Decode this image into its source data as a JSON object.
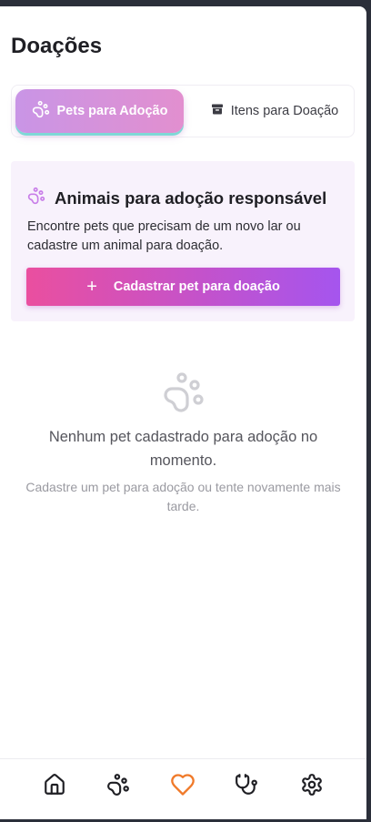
{
  "header": {
    "title": "Doações"
  },
  "tabs": [
    {
      "label": "Pets para Adoção",
      "icon": "paw-icon",
      "active": true
    },
    {
      "label": "Itens para Doação",
      "icon": "archive-box-icon",
      "active": false
    }
  ],
  "info_card": {
    "icon": "paw-icon",
    "title": "Animais para adoção responsável",
    "description": "Encontre pets que precisam de um novo lar ou cadastre um animal para doação.",
    "cta_icon": "plus-icon",
    "cta_label": "Cadastrar pet para doação"
  },
  "empty_state": {
    "icon": "paw-icon",
    "title": "Nenhum pet cadastrado para adoção no momento.",
    "subtitle": "Cadastre um pet para adoção ou tente novamente mais tarde."
  },
  "bottom_nav": [
    {
      "name": "home",
      "icon": "home-icon",
      "active": false
    },
    {
      "name": "pets",
      "icon": "paw-icon",
      "active": false
    },
    {
      "name": "donations",
      "icon": "heart-icon",
      "active": true
    },
    {
      "name": "health",
      "icon": "stethoscope-icon",
      "active": false
    },
    {
      "name": "settings",
      "icon": "gear-icon",
      "active": false
    }
  ],
  "colors": {
    "accent_pink": "#ea4f9f",
    "accent_purple": "#a555ee",
    "nav_active": "#f07a2a",
    "card_bg": "#f8f2fc"
  }
}
